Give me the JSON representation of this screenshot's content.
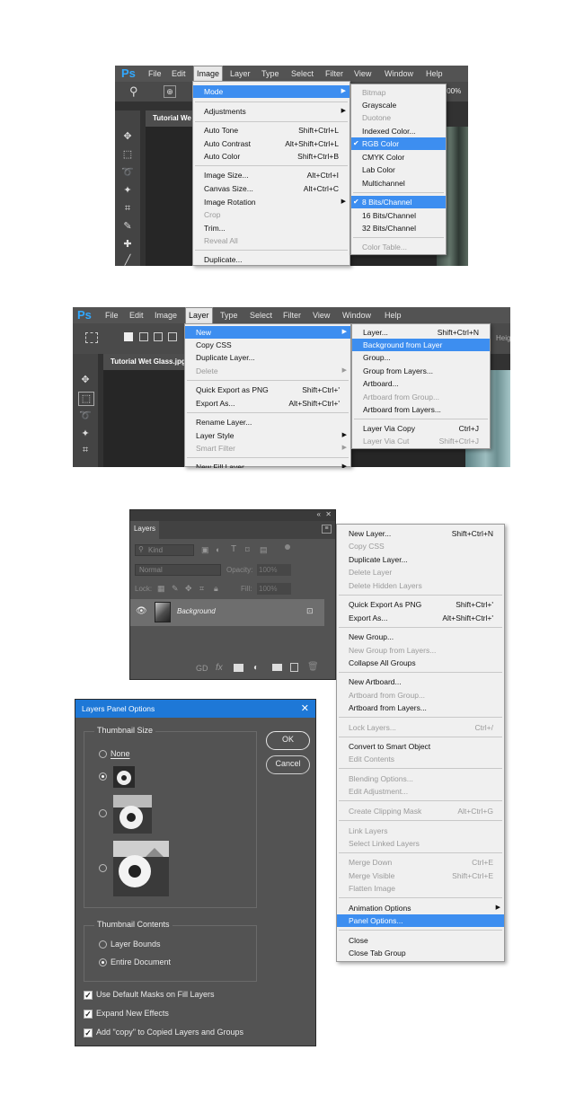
{
  "logo": "Ps",
  "s1": {
    "menus": [
      "File",
      "Edit",
      "Image",
      "Layer",
      "Type",
      "Select",
      "Filter",
      "View",
      "Window",
      "Help"
    ],
    "doc_tab": "Tutorial We",
    "zoom": ".00%",
    "image_menu": [
      {
        "label": "Mode",
        "shortcut": "",
        "arrow": true,
        "hi": true,
        "dis": false
      },
      {
        "label": "Adjustments",
        "shortcut": "",
        "arrow": true,
        "hi": false,
        "dis": false
      },
      {
        "label": "Auto Tone",
        "shortcut": "Shift+Ctrl+L",
        "dis": false
      },
      {
        "label": "Auto Contrast",
        "shortcut": "Alt+Shift+Ctrl+L",
        "dis": false
      },
      {
        "label": "Auto Color",
        "shortcut": "Shift+Ctrl+B",
        "dis": false
      },
      {
        "label": "Image Size...",
        "shortcut": "Alt+Ctrl+I",
        "dis": false
      },
      {
        "label": "Canvas Size...",
        "shortcut": "Alt+Ctrl+C",
        "dis": false
      },
      {
        "label": "Image Rotation",
        "shortcut": "",
        "arrow": true,
        "dis": false
      },
      {
        "label": "Crop",
        "shortcut": "",
        "dis": true
      },
      {
        "label": "Trim...",
        "shortcut": "",
        "dis": false
      },
      {
        "label": "Reveal All",
        "shortcut": "",
        "dis": true
      },
      {
        "label": "Duplicate...",
        "shortcut": "",
        "dis": false
      }
    ],
    "mode_menu": [
      {
        "label": "Bitmap",
        "dis": true
      },
      {
        "label": "Grayscale",
        "dis": false
      },
      {
        "label": "Duotone",
        "dis": true
      },
      {
        "label": "Indexed Color...",
        "dis": false
      },
      {
        "label": "RGB Color",
        "dis": false,
        "hi": true,
        "check": true
      },
      {
        "label": "CMYK Color",
        "dis": false
      },
      {
        "label": "Lab Color",
        "dis": false
      },
      {
        "label": "Multichannel",
        "dis": false
      },
      {
        "label": "8 Bits/Channel",
        "dis": false,
        "hi": true,
        "check": true
      },
      {
        "label": "16 Bits/Channel",
        "dis": false
      },
      {
        "label": "32 Bits/Channel",
        "dis": false
      },
      {
        "label": "Color Table...",
        "dis": true
      }
    ]
  },
  "s2": {
    "menus": [
      "File",
      "Edit",
      "Image",
      "Layer",
      "Type",
      "Select",
      "Filter",
      "View",
      "Window",
      "Help"
    ],
    "doc_tab": "Tutorial Wet Glass.jpg",
    "heg": "Heig",
    "layer_menu": [
      {
        "label": "New",
        "shortcut": "",
        "arrow": true,
        "hi": true,
        "dis": false
      },
      {
        "label": "Copy CSS",
        "shortcut": "",
        "dis": false
      },
      {
        "label": "Duplicate Layer...",
        "shortcut": "",
        "dis": false
      },
      {
        "label": "Delete",
        "shortcut": "",
        "arrow": true,
        "dis": true
      },
      {
        "label": "Quick Export as PNG",
        "shortcut": "Shift+Ctrl+'",
        "dis": false
      },
      {
        "label": "Export As...",
        "shortcut": "Alt+Shift+Ctrl+'",
        "dis": false
      },
      {
        "label": "Rename Layer...",
        "shortcut": "",
        "dis": false
      },
      {
        "label": "Layer Style",
        "shortcut": "",
        "arrow": true,
        "dis": false
      },
      {
        "label": "Smart Filter",
        "shortcut": "",
        "arrow": true,
        "dis": true
      },
      {
        "label": "New Fill Layer",
        "shortcut": "",
        "arrow": true,
        "dis": false
      }
    ],
    "new_menu": [
      {
        "label": "Layer...",
        "shortcut": "Shift+Ctrl+N",
        "dis": false
      },
      {
        "label": "Background from Layer",
        "shortcut": "",
        "dis": false,
        "hi": true
      },
      {
        "label": "Group...",
        "shortcut": "",
        "dis": false
      },
      {
        "label": "Group from Layers...",
        "shortcut": "",
        "dis": false
      },
      {
        "label": "Artboard...",
        "shortcut": "",
        "dis": false
      },
      {
        "label": "Artboard from Group...",
        "shortcut": "",
        "dis": true
      },
      {
        "label": "Artboard from Layers...",
        "shortcut": "",
        "dis": false
      },
      {
        "label": "Layer Via Copy",
        "shortcut": "Ctrl+J",
        "dis": false
      },
      {
        "label": "Layer Via Cut",
        "shortcut": "Shift+Ctrl+J",
        "dis": true
      }
    ]
  },
  "s3": {
    "panel_tab": "Layers",
    "kind": "Kind",
    "blend": "Normal",
    "opacity_label": "Opacity:",
    "opacity_value": "100%",
    "lock_label": "Lock:",
    "fill_label": "Fill:",
    "fill_value": "100%",
    "layer_name": "Background",
    "context_menu": [
      {
        "label": "New Layer...",
        "shortcut": "Shift+Ctrl+N",
        "dis": false
      },
      {
        "label": "Copy CSS",
        "shortcut": "",
        "dis": true
      },
      {
        "label": "Duplicate Layer...",
        "shortcut": "",
        "dis": false
      },
      {
        "label": "Delete Layer",
        "shortcut": "",
        "dis": true
      },
      {
        "label": "Delete Hidden Layers",
        "shortcut": "",
        "dis": true
      },
      {
        "label": "Quick Export As PNG",
        "shortcut": "Shift+Ctrl+'",
        "dis": false
      },
      {
        "label": "Export As...",
        "shortcut": "Alt+Shift+Ctrl+'",
        "dis": false
      },
      {
        "label": "New Group...",
        "shortcut": "",
        "dis": false
      },
      {
        "label": "New Group from Layers...",
        "shortcut": "",
        "dis": true
      },
      {
        "label": "Collapse All Groups",
        "shortcut": "",
        "dis": false
      },
      {
        "label": "New Artboard...",
        "shortcut": "",
        "dis": false
      },
      {
        "label": "Artboard from Group...",
        "shortcut": "",
        "dis": true
      },
      {
        "label": "Artboard from Layers...",
        "shortcut": "",
        "dis": false
      },
      {
        "label": "Lock Layers...",
        "shortcut": "Ctrl+/",
        "dis": true
      },
      {
        "label": "Convert to Smart Object",
        "shortcut": "",
        "dis": false
      },
      {
        "label": "Edit Contents",
        "shortcut": "",
        "dis": true
      },
      {
        "label": "Blending Options...",
        "shortcut": "",
        "dis": true
      },
      {
        "label": "Edit Adjustment...",
        "shortcut": "",
        "dis": true
      },
      {
        "label": "Create Clipping Mask",
        "shortcut": "Alt+Ctrl+G",
        "dis": true
      },
      {
        "label": "Link Layers",
        "shortcut": "",
        "dis": true
      },
      {
        "label": "Select Linked Layers",
        "shortcut": "",
        "dis": true
      },
      {
        "label": "Merge Down",
        "shortcut": "Ctrl+E",
        "dis": true
      },
      {
        "label": "Merge Visible",
        "shortcut": "Shift+Ctrl+E",
        "dis": true
      },
      {
        "label": "Flatten Image",
        "shortcut": "",
        "dis": true
      },
      {
        "label": "Animation Options",
        "shortcut": "",
        "arrow": true,
        "dis": false
      },
      {
        "label": "Panel Options...",
        "shortcut": "",
        "dis": false,
        "hi": true
      },
      {
        "label": "Close",
        "shortcut": "",
        "dis": false
      },
      {
        "label": "Close Tab Group",
        "shortcut": "",
        "dis": false
      }
    ]
  },
  "dialog": {
    "title": "Layers Panel Options",
    "close": "✕",
    "thumb_group": "Thumbnail Size",
    "none": "None",
    "contents_group": "Thumbnail Contents",
    "layer_bounds": "Layer Bounds",
    "entire_document": "Entire Document",
    "ok": "OK",
    "cancel": "Cancel",
    "cb1": "Use Default Masks on Fill Layers",
    "cb2": "Expand New Effects",
    "cb3": "Add \"copy\" to Copied Layers and Groups"
  },
  "colors": {
    "accent": "#3d8ef0",
    "ps_blue": "#31a8ff",
    "dialog_title": "#1e78d7"
  }
}
